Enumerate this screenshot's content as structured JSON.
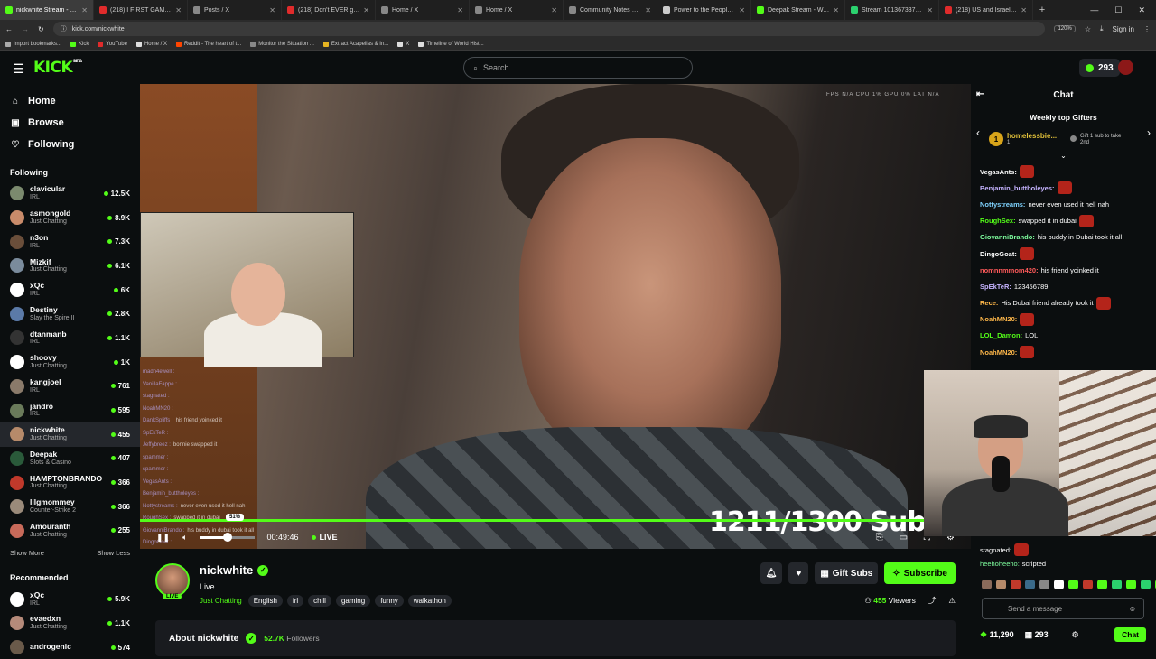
{
  "browser": {
    "tabs": [
      {
        "label": "nickwhite Stream - Wa",
        "color": "#53fc18",
        "active": true
      },
      {
        "label": "(218) I FIRST GAME A",
        "color": "#e02b2b"
      },
      {
        "label": "Posts / X",
        "color": "#888888"
      },
      {
        "label": "(218) Don't EVER go down",
        "color": "#e02b2b"
      },
      {
        "label": "Home / X",
        "color": "#888888"
      },
      {
        "label": "Home / X",
        "color": "#888888"
      },
      {
        "label": "Community Notes & Violati",
        "color": "#888888"
      },
      {
        "label": "Power to the People A",
        "color": "#cccccc"
      },
      {
        "label": "Deepak Stream - Watch Liv",
        "color": "#53fc18"
      },
      {
        "label": "Stream 101367337 - garyda",
        "color": "#2bd16e"
      },
      {
        "label": "(218) US and Israel Attack",
        "color": "#e02b2b"
      }
    ],
    "new_tab": "+",
    "url": "kick.com/nickwhite",
    "zoom": "120%",
    "sign_in": "Sign in",
    "bookmarks": [
      {
        "label": "Import bookmarks...",
        "color": "#aaaaaa"
      },
      {
        "label": "Kick",
        "color": "#53fc18"
      },
      {
        "label": "YouTube",
        "color": "#e02b2b"
      },
      {
        "label": "Home / X",
        "color": "#dddddd"
      },
      {
        "label": "Reddit - The heart of t...",
        "color": "#ff4500"
      },
      {
        "label": "Monitor the Situation ...",
        "color": "#888888"
      },
      {
        "label": "Extract Acapellas & In...",
        "color": "#e6b422"
      },
      {
        "label": "X",
        "color": "#dddddd"
      },
      {
        "label": "Timeline of World Hist...",
        "color": "#dddddd"
      }
    ]
  },
  "header": {
    "logo": "KICK",
    "logo_badge": "BETA",
    "search_placeholder": "Search",
    "points": "293"
  },
  "sidebar": {
    "nav": [
      {
        "label": "Home",
        "icon": "⌂"
      },
      {
        "label": "Browse",
        "icon": "▣"
      },
      {
        "label": "Following",
        "icon": "♡"
      }
    ],
    "following_title": "Following",
    "following": [
      {
        "name": "clavicular",
        "category": "IRL",
        "viewers": "12.5K",
        "color": "#7b8a6e"
      },
      {
        "name": "asmongold",
        "category": "Just Chatting",
        "viewers": "8.9K",
        "color": "#c98b6a"
      },
      {
        "name": "n3on",
        "category": "IRL",
        "viewers": "7.3K",
        "color": "#6a4e3a"
      },
      {
        "name": "Mizkif",
        "category": "Just Chatting",
        "viewers": "6.1K",
        "color": "#7a8b9c"
      },
      {
        "name": "xQc",
        "category": "IRL",
        "viewers": "6K",
        "color": "#ffffff"
      },
      {
        "name": "Destiny",
        "category": "Slay the Spire II",
        "viewers": "2.8K",
        "color": "#5b7aa8"
      },
      {
        "name": "dtanmanb",
        "category": "IRL",
        "viewers": "1.1K",
        "color": "#333333"
      },
      {
        "name": "shoovy",
        "category": "Just Chatting",
        "viewers": "1K",
        "color": "#ffffff"
      },
      {
        "name": "kangjoel",
        "category": "IRL",
        "viewers": "761",
        "color": "#8a7a6a"
      },
      {
        "name": "jandro",
        "category": "IRL",
        "viewers": "595",
        "color": "#6a7a5a"
      },
      {
        "name": "nickwhite",
        "category": "Just Chatting",
        "viewers": "455",
        "color": "#b68a6a",
        "selected": true
      },
      {
        "name": "Deepak",
        "category": "Slots & Casino",
        "viewers": "407",
        "color": "#2a5a3a"
      },
      {
        "name": "HAMPTONBRANDO",
        "category": "Just Chatting",
        "viewers": "366",
        "color": "#c0392b"
      },
      {
        "name": "lilgmommey",
        "category": "Counter-Strike 2",
        "viewers": "366",
        "color": "#9a8a7a"
      },
      {
        "name": "Amouranth",
        "category": "Just Chatting",
        "viewers": "255",
        "color": "#c86a5a"
      }
    ],
    "show_more": "Show More",
    "show_less": "Show Less",
    "recommended_title": "Recommended",
    "recommended": [
      {
        "name": "xQc",
        "category": "IRL",
        "viewers": "5.9K",
        "color": "#ffffff"
      },
      {
        "name": "evaedxn",
        "category": "Just Chatting",
        "viewers": "1.1K",
        "color": "#b58a7a"
      },
      {
        "name": "androgenic",
        "category": "",
        "viewers": "574",
        "color": "#6a5a4a"
      }
    ]
  },
  "video": {
    "hud": "FPS N/A   CPU 1%   GPU 0%   LAT N/A",
    "overlay_chat": [
      {
        "user": "madn4ewell :",
        "text": ""
      },
      {
        "user": "VanillaFappe :",
        "text": ""
      },
      {
        "user": "stagnated :",
        "text": ""
      },
      {
        "user": "NoahMN20 :",
        "text": ""
      },
      {
        "user": "DankSpliffs :",
        "text": "his friend yoinked it"
      },
      {
        "user": "SpEkTeR :",
        "text": ""
      },
      {
        "user": "Jeffybreez :",
        "text": "bonnie swapped it"
      },
      {
        "user": "spammer :",
        "text": ""
      },
      {
        "user": "spammer :",
        "text": ""
      },
      {
        "user": "VegasAnts :",
        "text": ""
      },
      {
        "user": "Benjamin_buttholeyes :",
        "text": ""
      },
      {
        "user": "Nottystreams :",
        "text": "never even used it hell nah"
      },
      {
        "user": "RoughSex :",
        "text": "swapped it in dubai"
      },
      {
        "user": "GiovanniBrando :",
        "text": "his buddy in dubai took it all"
      },
      {
        "user": "DingoGoat :",
        "text": ""
      }
    ],
    "sub_goal": "1211/1300 Sub",
    "volume_percent": 51,
    "volume_label": "51%",
    "time": "00:49:46",
    "live_label": "LIVE"
  },
  "stream": {
    "name": "nickwhite",
    "title": "Live",
    "live_badge": "LIVE",
    "category": "Just Chatting",
    "tags": [
      "English",
      "irl",
      "chill",
      "gaming",
      "funny",
      "walkathon"
    ],
    "gift_subs": "Gift Subs",
    "subscribe": "Subscribe",
    "viewers_count": "455",
    "viewers_label": "Viewers",
    "about_title": "About nickwhite",
    "followers_count": "52.7K",
    "followers_label": "Followers"
  },
  "chat": {
    "title": "Chat",
    "gifters_title": "Weekly top Gifters",
    "top_gifter_name": "homelessbie...",
    "top_gifter_count": "1",
    "gift_prompt_line1": "Gift 1 sub to take",
    "gift_prompt_line2": "2nd",
    "messages": [
      {
        "user": "VegasAnts:",
        "color": "#ffffff",
        "text": "",
        "emote": true
      },
      {
        "user": "Benjamin_buttholeyes:",
        "color": "#c5b3ff",
        "text": "",
        "emote": true
      },
      {
        "user": "Nottystreams:",
        "color": "#7fd3ff",
        "text": "never even used it hell nah",
        "emote": false
      },
      {
        "user": "RoughSex:",
        "color": "#53fc18",
        "text": "swapped it in dubai",
        "emote": true
      },
      {
        "user": "GiovanniBrando:",
        "color": "#7fff9f",
        "text": "his buddy in Dubai took it all",
        "emote": false
      },
      {
        "user": "DingoGoat:",
        "color": "#ffffff",
        "text": "",
        "emote": true
      },
      {
        "user": "nomnnmmom420:",
        "color": "#ff5a5a",
        "text": "his friend yoinked it",
        "emote": false
      },
      {
        "user": "SpEkTeR:",
        "color": "#c5b3ff",
        "text": "123456789",
        "emote": false
      },
      {
        "user": "Rece:",
        "color": "#ffb84a",
        "text": "His Dubai friend already took it",
        "emote": true
      },
      {
        "user": "NoahMN20:",
        "color": "#ffb84a",
        "text": "",
        "emote": true
      },
      {
        "user": "LOL_Damon:",
        "color": "#53fc18",
        "text": "LOL",
        "emote": false
      },
      {
        "user": "NoahMN20:",
        "color": "#ffb84a",
        "text": "",
        "emote": true
      }
    ],
    "late_messages": [
      {
        "user": "stagnated:",
        "color": "#ffffff",
        "text": "",
        "emote": true
      },
      {
        "user": "heehoheeho:",
        "color": "#7fff9f",
        "text": "scripted",
        "emote": false
      }
    ],
    "emote_colors": [
      "#8a6a5a",
      "#b58a6a",
      "#c0392b",
      "#3a6a8a",
      "#888888",
      "#ffffff",
      "#53fc18",
      "#c0392b",
      "#53fc18",
      "#2bd16e",
      "#53fc18",
      "#2bd16e",
      "#53fc18",
      "#7fff9f",
      "#2bd16e"
    ],
    "input_placeholder": "Send a message",
    "footer_points": "11,290",
    "footer_subs": "293",
    "chat_button": "Chat"
  }
}
